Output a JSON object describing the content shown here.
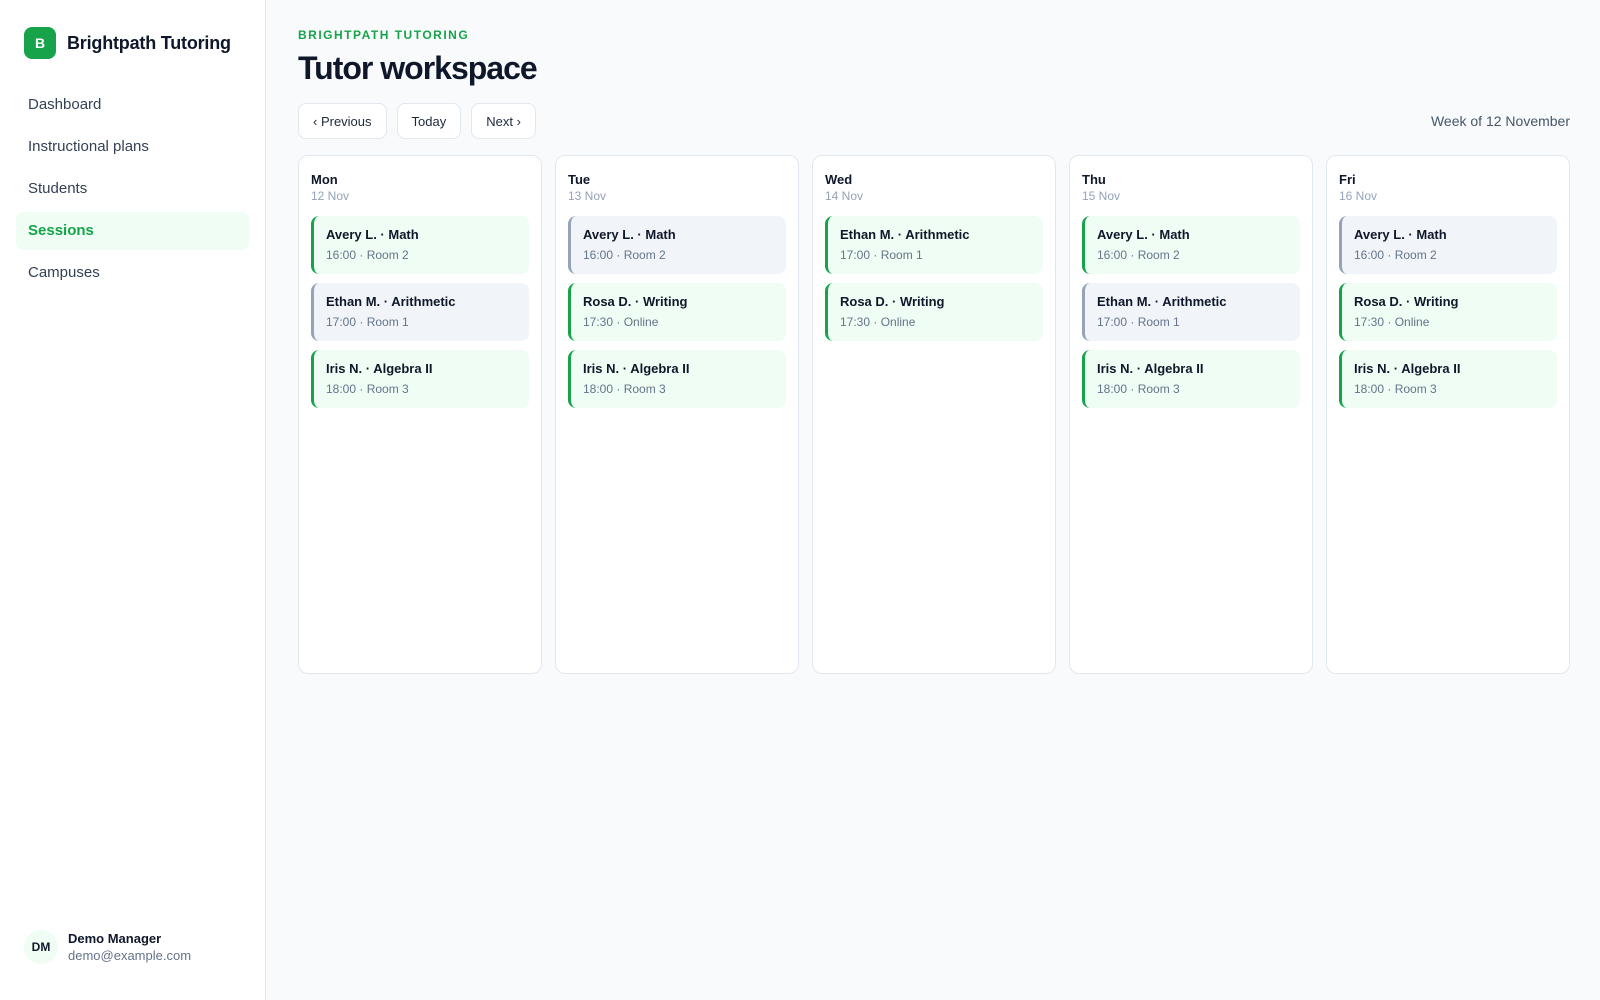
{
  "brand": {
    "logo_letter": "B",
    "name": "Brightpath Tutoring",
    "accent": "#16a34a"
  },
  "nav": {
    "items": [
      {
        "label": "Dashboard",
        "active": false
      },
      {
        "label": "Instructional plans",
        "active": false
      },
      {
        "label": "Students",
        "active": false
      },
      {
        "label": "Sessions",
        "active": true
      },
      {
        "label": "Campuses",
        "active": false
      }
    ]
  },
  "user": {
    "initials": "DM",
    "name": "Demo Manager",
    "email": "demo@example.com"
  },
  "header": {
    "eyebrow": "BRIGHTPATH TUTORING",
    "title": "Tutor workspace"
  },
  "toolbar": {
    "previous_label": "‹ Previous",
    "today_label": "Today",
    "next_label": "Next ›",
    "week_label": "Week of 12 November"
  },
  "days": [
    {
      "name": "Mon",
      "date": "12 Nov",
      "sessions": [
        {
          "title": "Avery L. · Math",
          "meta": "16:00 · Room 2",
          "style": "green"
        },
        {
          "title": "Ethan M. · Arithmetic",
          "meta": "17:00 · Room 1",
          "style": "muted"
        },
        {
          "title": "Iris N. · Algebra II",
          "meta": "18:00 · Room 3",
          "style": "green"
        }
      ]
    },
    {
      "name": "Tue",
      "date": "13 Nov",
      "sessions": [
        {
          "title": "Avery L. · Math",
          "meta": "16:00 · Room 2",
          "style": "muted"
        },
        {
          "title": "Rosa D. · Writing",
          "meta": "17:30 · Online",
          "style": "green"
        },
        {
          "title": "Iris N. · Algebra II",
          "meta": "18:00 · Room 3",
          "style": "green"
        }
      ]
    },
    {
      "name": "Wed",
      "date": "14 Nov",
      "sessions": [
        {
          "title": "Ethan M. · Arithmetic",
          "meta": "17:00 · Room 1",
          "style": "green"
        },
        {
          "title": "Rosa D. · Writing",
          "meta": "17:30 · Online",
          "style": "green"
        }
      ]
    },
    {
      "name": "Thu",
      "date": "15 Nov",
      "sessions": [
        {
          "title": "Avery L. · Math",
          "meta": "16:00 · Room 2",
          "style": "green"
        },
        {
          "title": "Ethan M. · Arithmetic",
          "meta": "17:00 · Room 1",
          "style": "muted"
        },
        {
          "title": "Iris N. · Algebra II",
          "meta": "18:00 · Room 3",
          "style": "green"
        }
      ]
    },
    {
      "name": "Fri",
      "date": "16 Nov",
      "sessions": [
        {
          "title": "Avery L. · Math",
          "meta": "16:00 · Room 2",
          "style": "muted"
        },
        {
          "title": "Rosa D. · Writing",
          "meta": "17:30 · Online",
          "style": "green"
        },
        {
          "title": "Iris N. · Algebra II",
          "meta": "18:00 · Room 3",
          "style": "green"
        }
      ]
    }
  ]
}
